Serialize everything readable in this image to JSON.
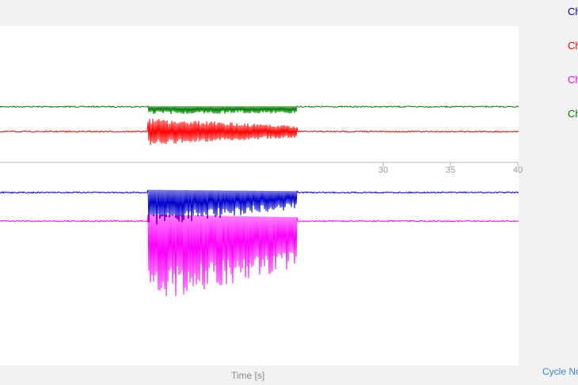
{
  "colors": {
    "page_bg": "#f2f2f2",
    "plot_bg": "#ffffff",
    "axis": "#b4b4b4",
    "grid": "#e4e4e4",
    "blue": "#0000cc",
    "red": "#ff0000",
    "magenta": "#ff00ff",
    "green": "#008000",
    "link": "#3a86c8"
  },
  "legend": [
    {
      "label": "Ch",
      "color": "#0000cc"
    },
    {
      "label": "Ch",
      "color": "#ff0000"
    },
    {
      "label": "Ch",
      "color": "#ff00ff"
    },
    {
      "label": "Ch",
      "color": "#008000"
    }
  ],
  "x_axis": {
    "title": "Time [s]",
    "ticks": [
      "30",
      "35",
      "40"
    ]
  },
  "cycle_link": "Cycle No",
  "chart_data": {
    "type": "line",
    "xlabel": "Time [s]",
    "xlim": [
      12,
      40
    ],
    "x_ticks": [
      30,
      35,
      40
    ],
    "grid": true,
    "signal_start_s": 12.5,
    "signal_end_s": 23.6,
    "series": [
      {
        "color": "#008000",
        "baseline": 0.74,
        "amplitude_start": 0.1,
        "amplitude_end": 0.09,
        "direction": "down"
      },
      {
        "color": "#ff0000",
        "baseline": 0.41,
        "amplitude_start": 0.18,
        "amplitude_end": 0.08,
        "direction": "both"
      },
      {
        "color": "#0000cc",
        "baseline": -0.4,
        "amplitude_start": 0.45,
        "amplitude_end": 0.22,
        "direction": "down"
      },
      {
        "color": "#ff00ff",
        "baseline": -0.78,
        "amplitude_start": 1.08,
        "amplitude_end": 0.65,
        "direction": "down"
      }
    ]
  }
}
